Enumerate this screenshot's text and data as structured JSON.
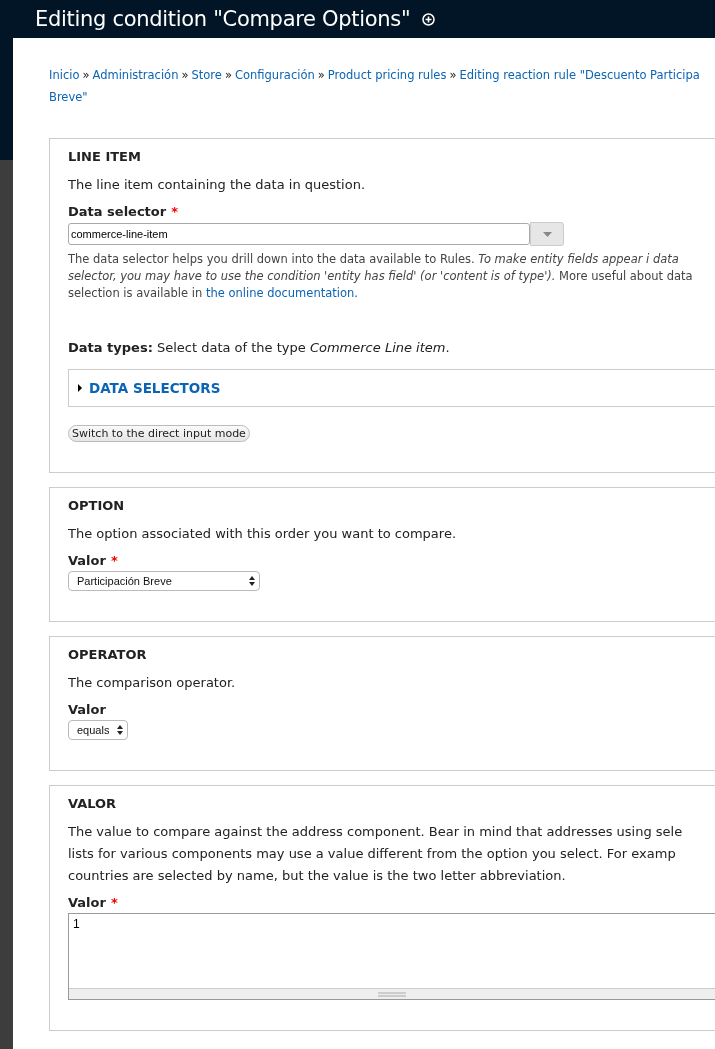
{
  "page_title": "Editing condition \"Compare Options\"",
  "breadcrumb": [
    "Inicio",
    "Administración",
    "Store",
    "Configuración",
    "Product pricing rules",
    "Editing reaction rule \"Descuento Participa"
  ],
  "breadcrumb_continuation": "Breve\"",
  "breadcrumb_separator": "»",
  "sections": [
    {
      "kind": "selector",
      "title": "LINE ITEM",
      "description": "The line item containing the data in question.",
      "label": "Data selector",
      "required_mark": "*",
      "value": "commerce-line-item",
      "help": [
        {
          "kind": "plain",
          "text": "The data selector helps you drill down into the data available to Rules. "
        },
        {
          "kind": "italic",
          "text": "To make entity fields appear i data selector, you may have to use the condition 'entity has field' (or 'content is of type')."
        },
        {
          "kind": "plain",
          "text": " More useful about data selection is available in "
        },
        {
          "kind": "link",
          "text": "the online documentation"
        },
        {
          "kind": "plain",
          "text": "."
        }
      ],
      "data_types": "**Data types:** Select data of the type *Commerce Line item*.",
      "details": {
        "label": "DATA SELECTORS",
        "expanded": false
      },
      "switch_button": "Switch to the direct input mode"
    },
    {
      "kind": "select",
      "title": "OPTION",
      "description": "The option associated with this order you want to compare.",
      "label": "Valor",
      "required_mark": "*",
      "value": "Participación Breve",
      "wide": true
    },
    {
      "kind": "select",
      "title": "OPERATOR",
      "description": "The comparison operator.",
      "label": "Valor",
      "value": "equals",
      "wide": false
    },
    {
      "kind": "textarea",
      "title": "VALOR",
      "description": "The value to compare against the address component. Bear in mind that addresses using sele lists for various components may use a value different from the option you select. For examp countries are selected by name, but the value is the two letter abbreviation.",
      "label": "Valor",
      "required_mark": "*",
      "value": "1"
    }
  ]
}
